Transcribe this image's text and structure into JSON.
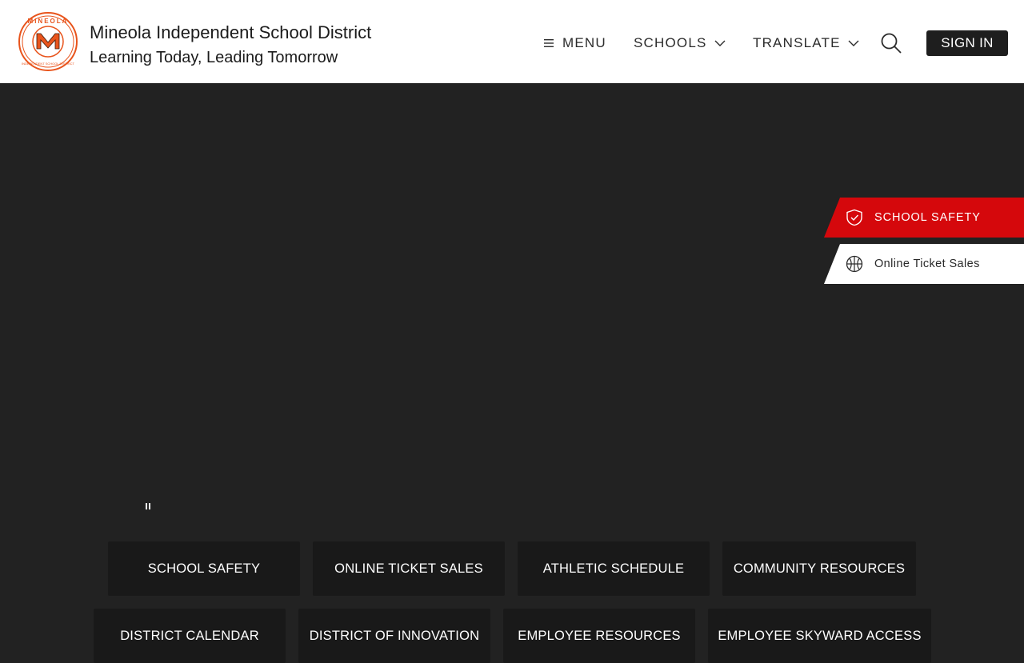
{
  "header": {
    "site_name": "Mineola Independent School District",
    "tagline": "Learning Today, Leading Tomorrow",
    "logo": {
      "icon": "district-seal-logo",
      "text_top": "MINEOLA",
      "text_center": "M",
      "text_bottom": "INDEPENDENT SCHOOL DISTRICT",
      "colors": {
        "primary": "#e8541c",
        "outline": "#1b1b1b"
      }
    },
    "nav": {
      "menu_label": "MENU",
      "menu_icon": "hamburger-icon",
      "schools_label": "SCHOOLS",
      "translate_label": "TRANSLATE",
      "dropdown_icon": "chevron-down-icon"
    },
    "search_icon": "search-icon",
    "sign_in_label": "SIGN IN"
  },
  "quick_links": [
    {
      "label": "SCHOOL SAFETY",
      "icon": "shield-check-icon",
      "bg_color": "#d5080c"
    },
    {
      "label": "Online Ticket Sales",
      "icon": "basketball-icon",
      "bg_color": "#ffffff"
    }
  ],
  "carousel": {
    "pause_icon": "pause-icon"
  },
  "tiles_row1": [
    "SCHOOL SAFETY",
    "ONLINE TICKET SALES",
    "ATHLETIC SCHEDULE",
    "COMMUNITY RESOURCES"
  ],
  "tiles_row2": [
    "DISTRICT CALENDAR",
    "DISTRICT OF INNOVATION",
    "EMPLOYEE RESOURCES",
    "EMPLOYEE SKYWARD ACCESS"
  ],
  "colors": {
    "accent": "#d5080c",
    "hero_bg": "#222222",
    "tile_bg": "#191919"
  }
}
